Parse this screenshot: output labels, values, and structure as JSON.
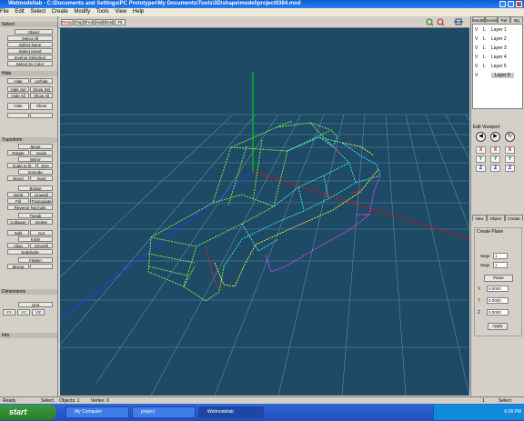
{
  "window": {
    "title": "Wetmodellab - C:\\Documents and Settings\\PC Prototyper\\My Documents\\Tools\\3D\\shape\\model\\project0384.mod"
  },
  "menu": [
    "File",
    "Edit",
    "Select",
    "Create",
    "Modify",
    "Tools",
    "View",
    "Help"
  ],
  "left_panel": {
    "sections": [
      {
        "title": "Select",
        "buttons": [
          "Object",
          "Select All",
          "Select None",
          "Select Invert",
          "Inverse Selection",
          "Select by Color"
        ]
      },
      {
        "title": "Hide",
        "buttons": [
          "Hide",
          "Unhide",
          "Hide Sel",
          "Show Sel",
          "Hide All",
          "Show All",
          "Hide",
          "Show"
        ]
      },
      {
        "title": "Transform",
        "buttons": [
          "Move",
          "Rotate",
          "Scale",
          "Mirror",
          "Scale to fit",
          "Size",
          "Extrude",
          "Bevel",
          "Inset",
          "Bridge",
          "Weld",
          "Unweld",
          "Fill",
          "Triangulate",
          "Reverse Normals",
          "Tweak",
          "Collapse",
          "Delete",
          "Split",
          "Cut",
          "Knife",
          "Align",
          "Smooth",
          "Subdivide",
          "Flatten",
          "Merge"
        ]
      },
      {
        "title": "Dimensions",
        "buttons": [
          "Unit",
          "XY",
          "XZ",
          "YZ"
        ]
      },
      {
        "title": "Info",
        "buttons": []
      }
    ]
  },
  "viewport": {
    "toolbar": [
      "Persp",
      "Top",
      "Front",
      "Side",
      "Grid",
      "Fit"
    ],
    "zoom_icons": [
      "zoom-in",
      "zoom-out",
      "fit"
    ]
  },
  "right_panel": {
    "tabs": [
      "Model",
      "Scene",
      "Ref",
      "Bg"
    ],
    "layers": [
      {
        "visible": "V",
        "locked": "L",
        "name": "Layer 1"
      },
      {
        "visible": "V",
        "locked": "L",
        "name": "Layer 2"
      },
      {
        "visible": "V",
        "locked": "L",
        "name": "Layer 3"
      },
      {
        "visible": "V",
        "locked": "L",
        "name": "Layer 4"
      },
      {
        "visible": "V",
        "locked": "L",
        "name": "Layer 5"
      },
      {
        "visible": "V",
        "locked": "",
        "name": "Layer 6"
      }
    ],
    "edit_view": {
      "title": "Edit Viewport",
      "circle_buttons": [
        "◀",
        "▶",
        "↻"
      ],
      "axis_rows": [
        {
          "label": "X",
          "a": "X",
          "b": "X",
          "color": "#c00000"
        },
        {
          "label": "Y",
          "a": "Y",
          "b": "Y",
          "color": "#008000"
        },
        {
          "label": "Z",
          "a": "Z",
          "b": "Z",
          "color": "#0000c0"
        }
      ]
    },
    "create_tabs": [
      "New",
      "Object",
      "Create"
    ],
    "create_panel": {
      "title": "Create Plane",
      "segment_labels": [
        "Segs",
        "Segs"
      ],
      "segment_values": [
        "1",
        "1"
      ],
      "action": "Plane",
      "fields": [
        {
          "label": "X",
          "value": "0.0000"
        },
        {
          "label": "Y",
          "value": "0.0000"
        },
        {
          "label": "Z",
          "value": "0.0000"
        }
      ],
      "apply": "Apply"
    }
  },
  "statusbar": {
    "items": [
      "Ready",
      "Select",
      "Objects: 1",
      "Vertex: 0"
    ],
    "right": [
      "1",
      "Select"
    ]
  },
  "taskbar": {
    "start": "start",
    "items": [
      {
        "label": "My Computer",
        "active": false
      },
      {
        "label": "project",
        "active": false
      },
      {
        "label": "Wetmodellab",
        "active": true
      }
    ],
    "tray": "6:08 PM"
  },
  "colors": {
    "viewport_bg": "#1f4a66",
    "grid": "#5f8aa3",
    "body_green": "#7cff4a",
    "body_cyan": "#3ff0ff",
    "accent_magenta": "#ff3dff",
    "accent_yellow": "#ffff30",
    "accent_red": "#ff2020",
    "axis_green": "#00e000",
    "axis_red": "#d01010",
    "axis_blue": "#2040ff"
  }
}
